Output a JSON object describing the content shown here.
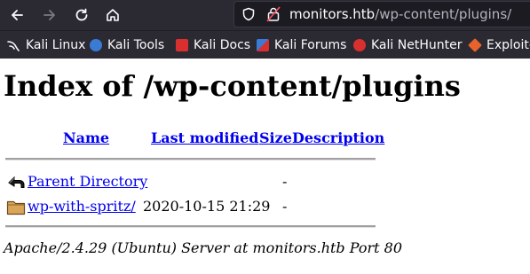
{
  "browser": {
    "url_host": "monitors.htb",
    "url_path": "/wp-content/plugins/",
    "bookmarks": [
      "Kali Linux",
      "Kali Tools",
      "Kali Docs",
      "Kali Forums",
      "Kali NetHunter",
      "Exploit-"
    ]
  },
  "page": {
    "title": "Index of /wp-content/plugins",
    "columns": {
      "name": "Name",
      "last_modified": "Last modified",
      "size": "Size",
      "description": "Description"
    },
    "rows": [
      {
        "name": "Parent Directory",
        "icon": "back-icon",
        "modified": "",
        "size": "-",
        "description": ""
      },
      {
        "name": "wp-with-spritz/",
        "icon": "folder-icon",
        "modified": "2020-10-15 21:29",
        "size": "-",
        "description": ""
      }
    ],
    "footer": "Apache/2.4.29 (Ubuntu) Server at monitors.htb Port 80"
  }
}
